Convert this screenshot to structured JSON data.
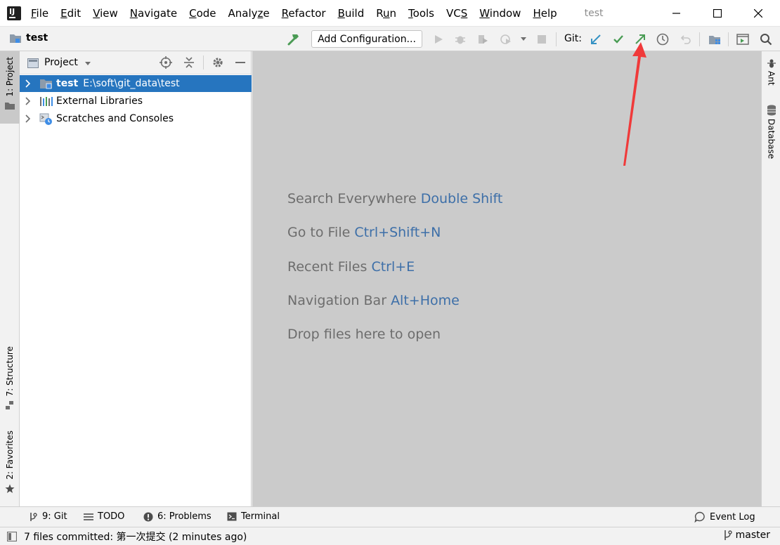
{
  "menubar": {
    "items": [
      {
        "label": "File",
        "mnemonic": "F"
      },
      {
        "label": "Edit",
        "mnemonic": "E"
      },
      {
        "label": "View",
        "mnemonic": "V"
      },
      {
        "label": "Navigate",
        "mnemonic": "N"
      },
      {
        "label": "Code",
        "mnemonic": "C"
      },
      {
        "label": "Analyze",
        "mnemonic": "z"
      },
      {
        "label": "Refactor",
        "mnemonic": "R"
      },
      {
        "label": "Build",
        "mnemonic": "B"
      },
      {
        "label": "Run",
        "mnemonic": "u"
      },
      {
        "label": "Tools",
        "mnemonic": "T"
      },
      {
        "label": "VCS",
        "mnemonic": "S"
      },
      {
        "label": "Window",
        "mnemonic": "W"
      },
      {
        "label": "Help",
        "mnemonic": "H"
      }
    ],
    "window_title": "test"
  },
  "toolbar": {
    "project_name": "test",
    "add_configuration_label": "Add Configuration...",
    "git_label": "Git:"
  },
  "left_stripe": {
    "project_tab": "1: Project",
    "structure_tab": "7: Structure",
    "favorites_tab": "2: Favorites"
  },
  "project_panel": {
    "title": "Project",
    "tree": [
      {
        "name": "test",
        "path": "E:\\soft\\git_data\\test",
        "selected": true,
        "icon": "module-folder-icon"
      },
      {
        "name": "External Libraries",
        "path": "",
        "selected": false,
        "icon": "libraries-icon"
      },
      {
        "name": "Scratches and Consoles",
        "path": "",
        "selected": false,
        "icon": "scratches-icon"
      }
    ]
  },
  "editor": {
    "hints": [
      {
        "text": "Search Everywhere",
        "key": "Double Shift"
      },
      {
        "text": "Go to File",
        "key": "Ctrl+Shift+N"
      },
      {
        "text": "Recent Files",
        "key": "Ctrl+E"
      },
      {
        "text": "Navigation Bar",
        "key": "Alt+Home"
      },
      {
        "text": "Drop files here to open",
        "key": ""
      }
    ]
  },
  "right_stripe": {
    "ant_tab": "Ant",
    "database_tab": "Database"
  },
  "bottom_bar": {
    "git_tab": "9: Git",
    "todo_tab": "TODO",
    "problems_tab": "6: Problems",
    "terminal_tab": "Terminal",
    "event_log_tab": "Event Log"
  },
  "status_bar": {
    "message": "7 files committed: 第一次提交 (2 minutes ago)",
    "branch": "master"
  },
  "colors": {
    "selection": "#2675bf",
    "editor_bg": "#cbcbcb",
    "shortcut_key": "#3d6fa8",
    "git_update": "#3592c4",
    "git_commit": "#499c54",
    "annotation_arrow": "#f03a3a"
  }
}
